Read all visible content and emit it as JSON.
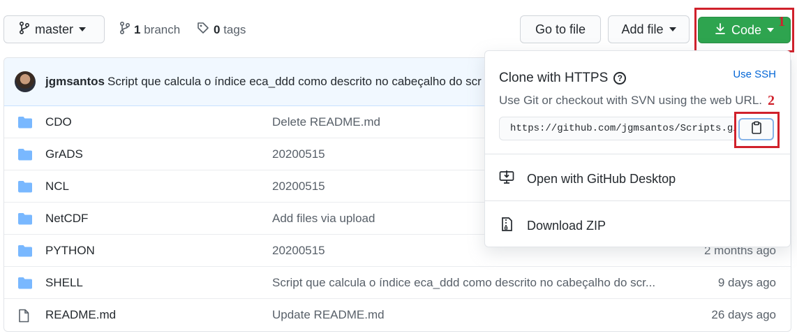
{
  "toolbar": {
    "branch_name": "master",
    "branch_count": "1",
    "branch_label": "branch",
    "tag_count": "0",
    "tag_label": "tags",
    "goto_label": "Go to file",
    "addfile_label": "Add file",
    "code_label": "Code"
  },
  "annotations": {
    "first": "1",
    "second": "2"
  },
  "commit": {
    "author": "jgmsantos",
    "message": "Script que calcula o índice eca_ddd como descrito no cabeçalho do scr"
  },
  "files": [
    {
      "icon": "folder-icon",
      "name": "CDO",
      "message": "Delete README.md",
      "age": ""
    },
    {
      "icon": "folder-icon",
      "name": "GrADS",
      "message": "20200515",
      "age": ""
    },
    {
      "icon": "folder-icon",
      "name": "NCL",
      "message": "20200515",
      "age": ""
    },
    {
      "icon": "folder-icon",
      "name": "NetCDF",
      "message": "Add files via upload",
      "age": ""
    },
    {
      "icon": "folder-icon",
      "name": "PYTHON",
      "message": "20200515",
      "age": "2 months ago"
    },
    {
      "icon": "folder-icon",
      "name": "SHELL",
      "message": "Script que calcula o índice eca_ddd como descrito no cabeçalho do scr...",
      "age": "9 days ago"
    },
    {
      "icon": "file-icon",
      "name": "README.md",
      "message": "Update README.md",
      "age": "26 days ago"
    }
  ],
  "dropdown": {
    "title": "Clone with HTTPS",
    "use_ssh": "Use SSH",
    "description": "Use Git or checkout with SVN using the web URL.",
    "url": "https://github.com/jgmsantos/Scripts.git",
    "desktop_label": "Open with GitHub Desktop",
    "zip_label": "Download ZIP"
  },
  "colors": {
    "accent_green": "#2ea44f",
    "highlight_red": "#d0212b",
    "link_blue": "#0366d6",
    "folder_blue": "#79b8ff"
  }
}
